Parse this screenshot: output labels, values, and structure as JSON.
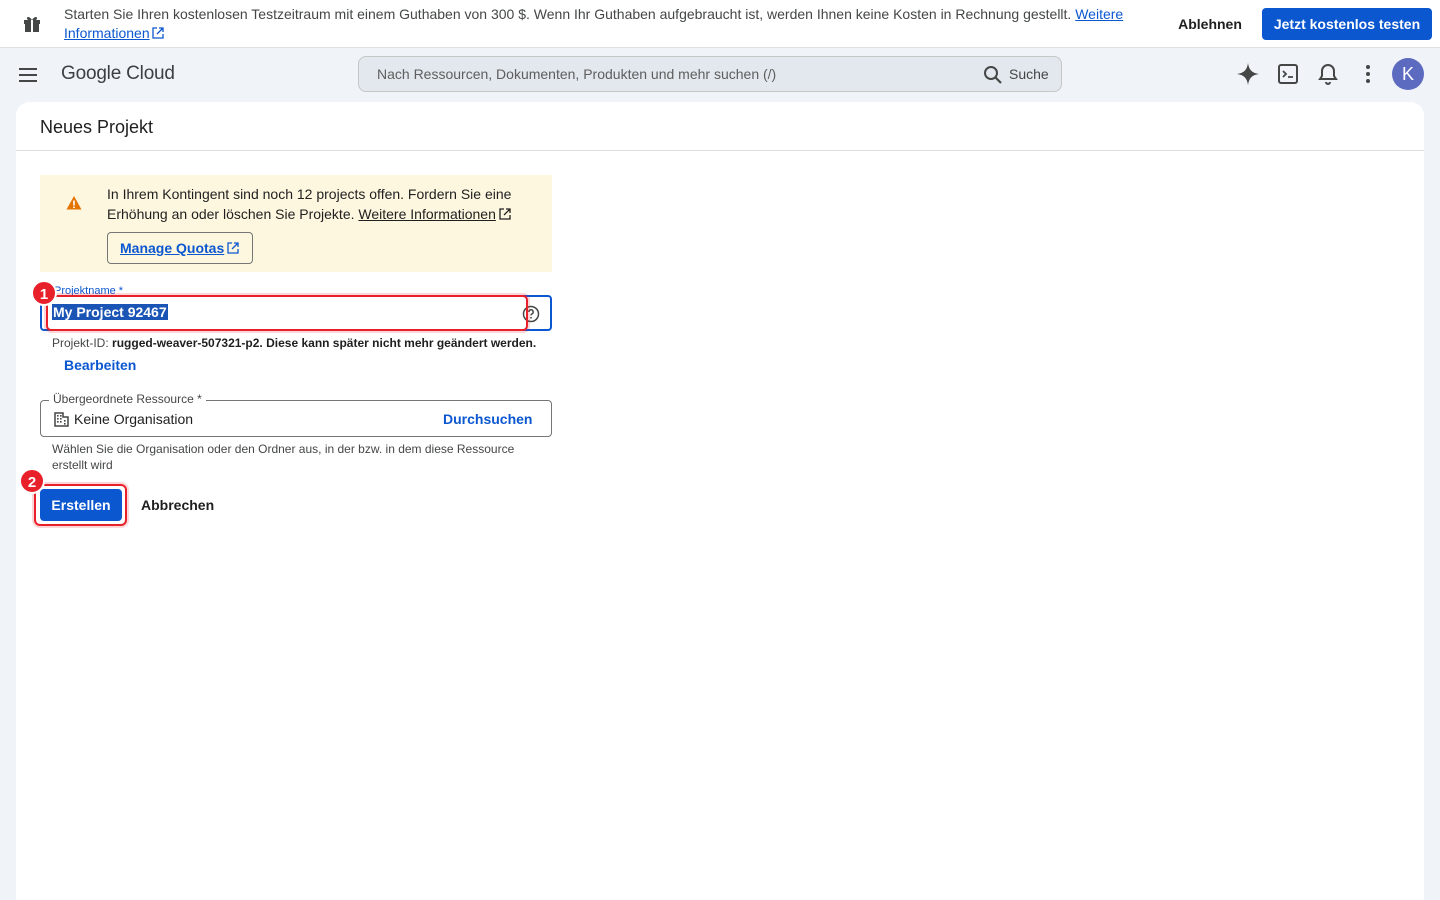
{
  "promo": {
    "message": "Starten Sie Ihren kostenlosen Testzeitraum mit einem Guthaben von 300 $. Wenn Ihr Guthaben aufgebraucht ist, werden Ihnen keine Kosten in Rechnung gestellt.",
    "link_label": "Weitere Informationen",
    "decline_label": "Ablehnen",
    "trial_label": "Jetzt kostenlos testen"
  },
  "header": {
    "logo": "Google Cloud",
    "search_placeholder": "Nach Ressourcen, Dokumenten, Produkten und mehr suchen (/)",
    "search_button": "Suche",
    "avatar_initial": "K",
    "icons": [
      "gemini-icon",
      "cloud-shell-icon",
      "notifications-icon",
      "more-vert-icon"
    ]
  },
  "page": {
    "title": "Neues Projekt"
  },
  "warning": {
    "text": "In Ihrem Kontingent sind noch 12 projects offen. Fordern Sie eine Erhöhung an oder löschen Sie Projekte.",
    "link_label": "Weitere Informationen",
    "button_label": "Manage Quotas"
  },
  "project_name": {
    "label": "Projektname *",
    "value": "My Project 92467",
    "id_prefix": "Projekt-ID:",
    "id_value": "rugged-weaver-507321-p2.",
    "id_suffix": "Diese kann später nicht mehr geändert werden.",
    "edit_label": "Bearbeiten"
  },
  "parent_resource": {
    "label": "Übergeordnete Ressource *",
    "value": "Keine Organisation",
    "browse_label": "Durchsuchen",
    "hint": "Wählen Sie die Organisation oder den Ordner aus, in der bzw. in dem diese Ressource erstellt wird"
  },
  "actions": {
    "create_label": "Erstellen",
    "cancel_label": "Abbrechen"
  },
  "annotations": {
    "badge_1": "1",
    "badge_2": "2"
  },
  "colors": {
    "primary": "#0b57d0",
    "annotation_red": "#e8202a",
    "warning_bg": "#fef7e0",
    "warning_icon": "#e37400"
  }
}
